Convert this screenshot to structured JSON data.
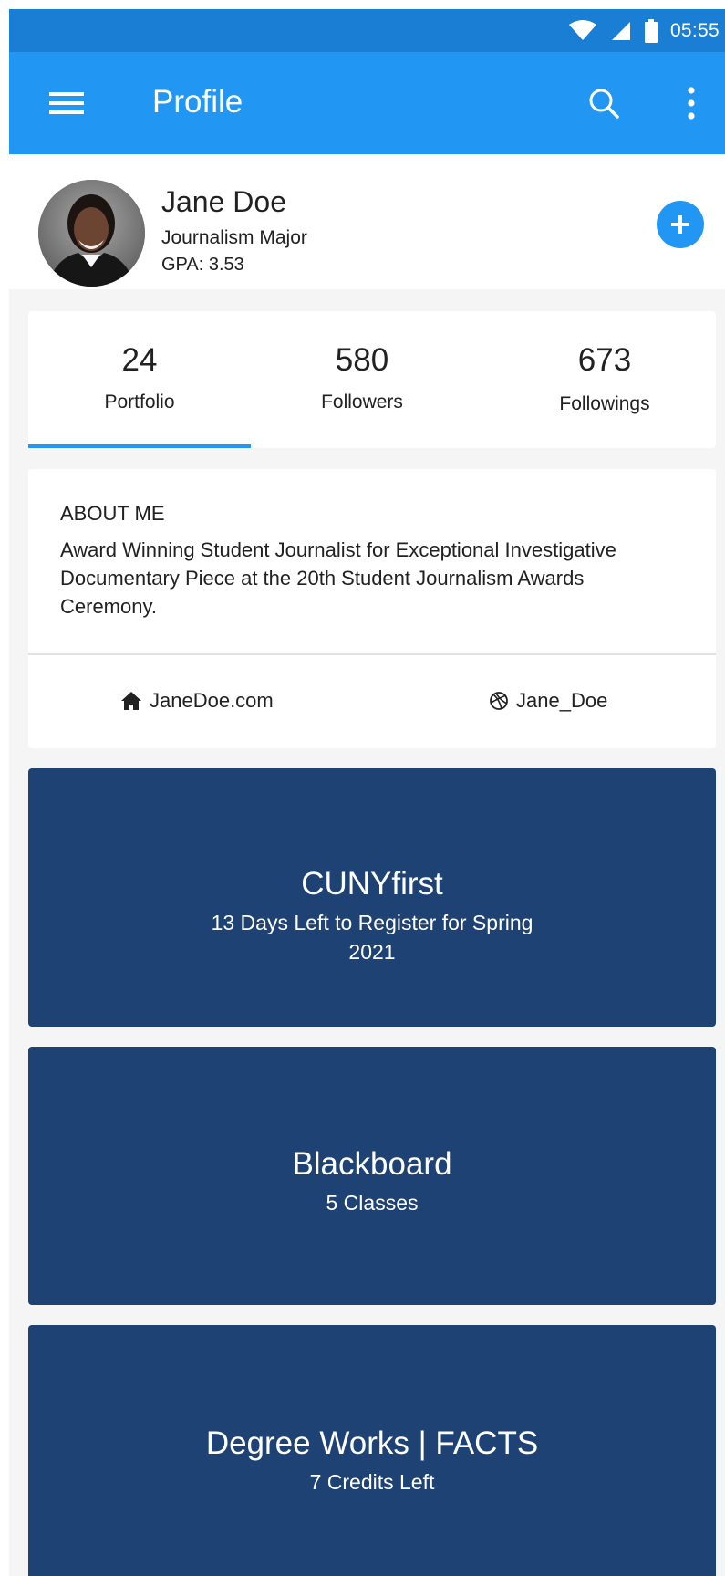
{
  "status_bar": {
    "time": "05:55",
    "icons": [
      "wifi-icon",
      "cell-signal-icon",
      "battery-icon"
    ]
  },
  "app_bar": {
    "title": "Profile",
    "icons": [
      "menu-icon",
      "search-icon",
      "more-vert-icon"
    ]
  },
  "profile": {
    "name": "Jane Doe",
    "major": "Journalism Major",
    "gpa": "GPA: 3.53",
    "add_icon": "plus-icon"
  },
  "stats": [
    {
      "value": "24",
      "label": "Portfolio",
      "selected": true
    },
    {
      "value": "580",
      "label": "Followers",
      "selected": false
    },
    {
      "value": "673",
      "label": "Followings",
      "selected": false
    }
  ],
  "about": {
    "title": "ABOUT ME",
    "text": "Award Winning Student Journalist for Exceptional Investigative Documentary Piece at the 20th Student Journalism Awards Ceremony.",
    "website": {
      "icon": "home-icon",
      "label": "JaneDoe.com"
    },
    "dribbble": {
      "icon": "dribbble-icon",
      "label": "Jane_Doe"
    }
  },
  "tiles": [
    {
      "title": "CUNYfirst",
      "subtitle": "13 Days Left to Register for Spring 2021"
    },
    {
      "title": "Blackboard",
      "subtitle": "5 Classes"
    },
    {
      "title": "Degree Works | FACTS",
      "subtitle": "7 Credits Left"
    }
  ],
  "colors": {
    "status_bar": "#1a7fd4",
    "app_bar": "#2196f3",
    "accent": "#2196f3",
    "tile": "#1f4275",
    "background": "#f5f5f5"
  }
}
